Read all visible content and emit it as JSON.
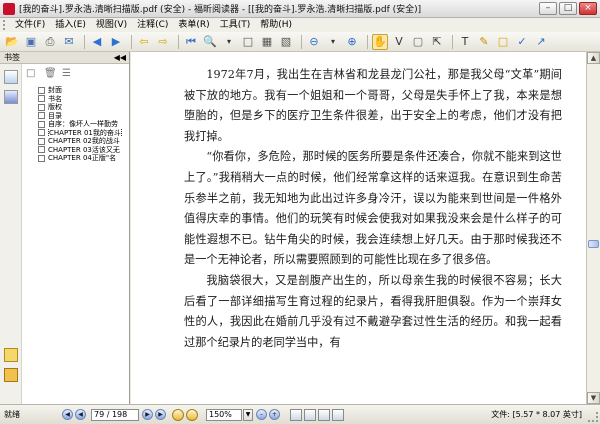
{
  "window": {
    "title": "[我的奋斗].罗永浩.清晰扫描版.pdf (安全) - 福昕阅读器 - [[我的奋斗].罗永浩.清晰扫描版.pdf (安全)]"
  },
  "menu": [
    "文件(F)",
    "插入(E)",
    "视图(V)",
    "注释(C)",
    "表单(R)",
    "工具(T)",
    "帮助(H)"
  ],
  "sidebar": {
    "header": "书签",
    "bookmarks": [
      "封面",
      "书名",
      "版权",
      "目录",
      "自序：像坏人一样勤劳",
      "CHAPTER 01我的奋斗",
      "CHAPTER 02我的战斗",
      "CHAPTER 03活该又无",
      "CHAPTER 04正版\"名"
    ]
  },
  "document": {
    "paragraphs": [
      "1972年7月，我出生在吉林省和龙县龙门公社，那是我父母“文革”期间被下放的地方。我有一个姐姐和一个哥哥，父母是失手怀上了我，本来是想堕胎的，但是乡下的医疗卫生条件很差，出于安全上的考虑，他们才没有把我打掉。",
      "“你看你，多危险，那时候的医务所要是条件还凑合，你就不能来到这世上了。”我稍稍大一点的时候，他们经常拿这样的话来逗我。在意识到生命苦乐参半之前，我无知地为此出过许多身冷汗，误以为能来到世间是一件格外值得庆幸的事情。他们的玩笑有时候会使我对如果我没来会是什么样子的可能性遐想不已。钻牛角尖的时候，我会连续想上好几天。由于那时候我还不是一个无神论者，所以需要照顾到的可能性比现在多了很多倍。",
      "我脑袋很大，又是剖腹产出生的，所以母亲生我的时候很不容易；长大后看了一部详细描写生育过程的纪录片，看得我肝胆俱裂。作为一个崇拜女性的人，我因此在婚前几乎没有过不戴避孕套过性生活的经历。和我一起看过那个纪录片的老同学当中，有"
    ]
  },
  "status": {
    "ready": "就绪",
    "page": "79 / 198",
    "zoom": "150%",
    "file_info": "文件: [5.57 * 8.07 英寸]"
  },
  "colors": {
    "close_button": "#cc3333",
    "nav_icon": "#8fa8de",
    "scroll_thumb": "#a9bee8"
  }
}
